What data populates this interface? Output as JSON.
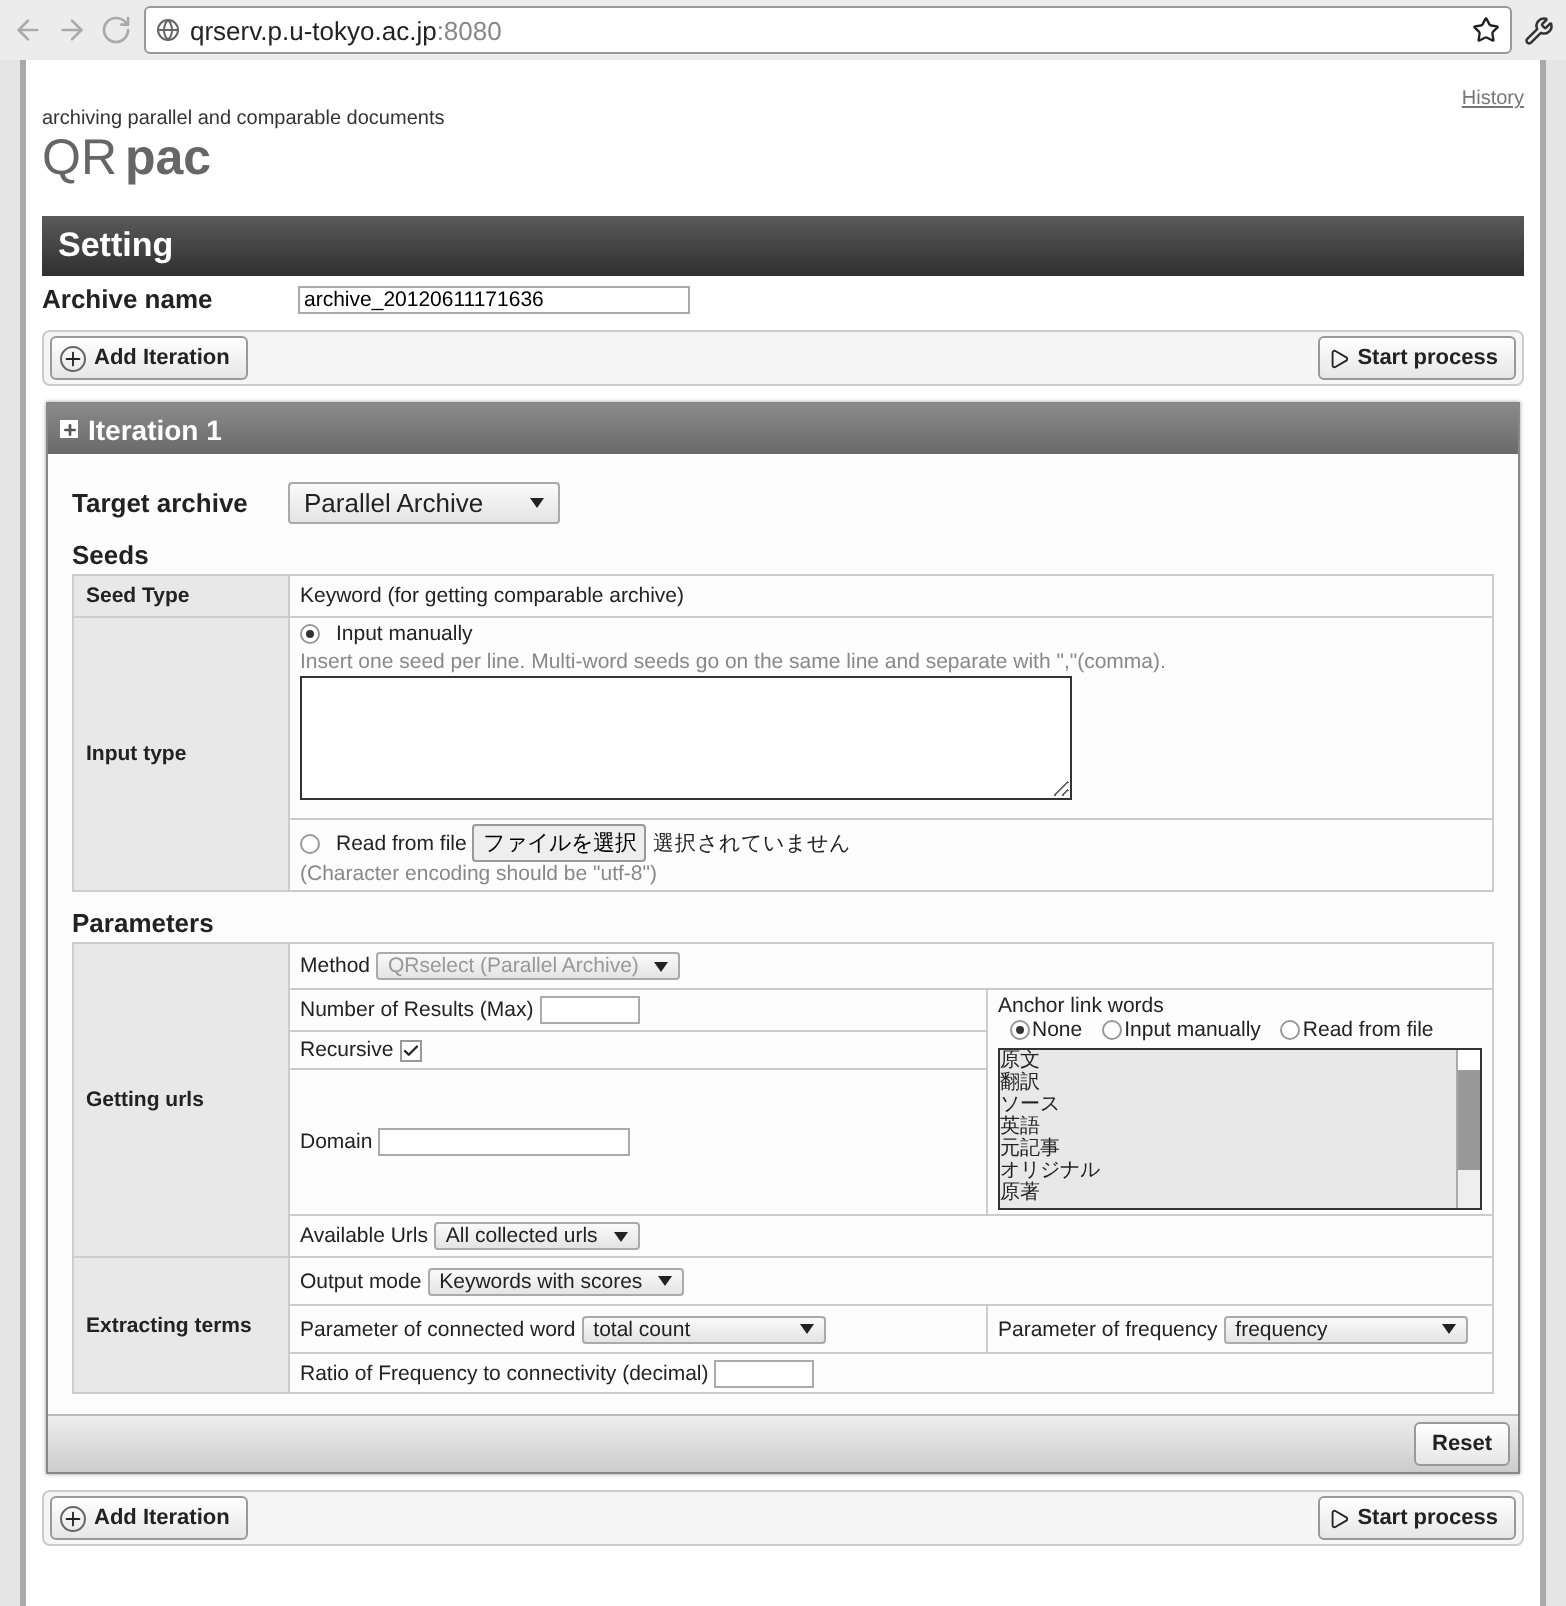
{
  "browser": {
    "url_host": "qrserv.p.u-tokyo.ac.jp",
    "url_port": ":8080"
  },
  "header": {
    "history_link": "History",
    "tagline": "archiving parallel and comparable documents",
    "logo_light": "QR",
    "logo_bold": "pac"
  },
  "setting": {
    "title": "Setting",
    "archive_label": "Archive name",
    "archive_value": "archive_20120611171636"
  },
  "top_actions": {
    "add": "Add Iteration",
    "start": "Start process"
  },
  "iteration": {
    "title": "Iteration 1",
    "expanded": false,
    "target_label": "Target archive",
    "target_value": "Parallel Archive",
    "seeds": {
      "heading": "Seeds",
      "seed_type_label": "Seed Type",
      "seed_type_value": "Keyword (for getting comparable archive)",
      "input_type_label": "Input type",
      "options": [
        {
          "kind": "manual",
          "label": "Input manually",
          "selected": true,
          "hint": "Insert one seed per line. Multi-word seeds go on the same line and separate with \",\"(comma)."
        },
        {
          "kind": "file",
          "label": "Read from file",
          "selected": false,
          "file_button": "ファイルを選択",
          "file_status": "選択されていません",
          "hint": "(Character encoding should be \"utf-8\")"
        }
      ]
    },
    "parameters": {
      "heading": "Parameters",
      "getting_urls": {
        "label": "Getting urls",
        "method_label": "Method",
        "method_value": "QRselect (Parallel Archive)",
        "method_disabled": true,
        "results_label": "Number of Results (Max)",
        "recursive_label": "Recursive",
        "recursive_checked": true,
        "domain_label": "Domain",
        "anchor_label": "Anchor link words",
        "anchor_options": [
          {
            "label": "None",
            "selected": true
          },
          {
            "label": "Input manually",
            "selected": false
          },
          {
            "label": "Read from file",
            "selected": false
          }
        ],
        "anchor_words": [
          "原文",
          "翻訳",
          "ソース",
          "英語",
          "元記事",
          "オリジナル",
          "原著"
        ],
        "available_label": "Available Urls",
        "available_value": "All collected urls"
      },
      "extracting_terms": {
        "label": "Extracting terms",
        "output_label": "Output mode",
        "output_value": "Keywords with scores",
        "connected_label": "Parameter of connected word",
        "connected_value": "total count",
        "frequency_label": "Parameter of frequency",
        "frequency_value": "frequency",
        "ratio_label": "Ratio of Frequency to connectivity (decimal)"
      }
    },
    "reset": "Reset"
  },
  "bottom_actions": {
    "add": "Add Iteration",
    "start": "Start process"
  }
}
